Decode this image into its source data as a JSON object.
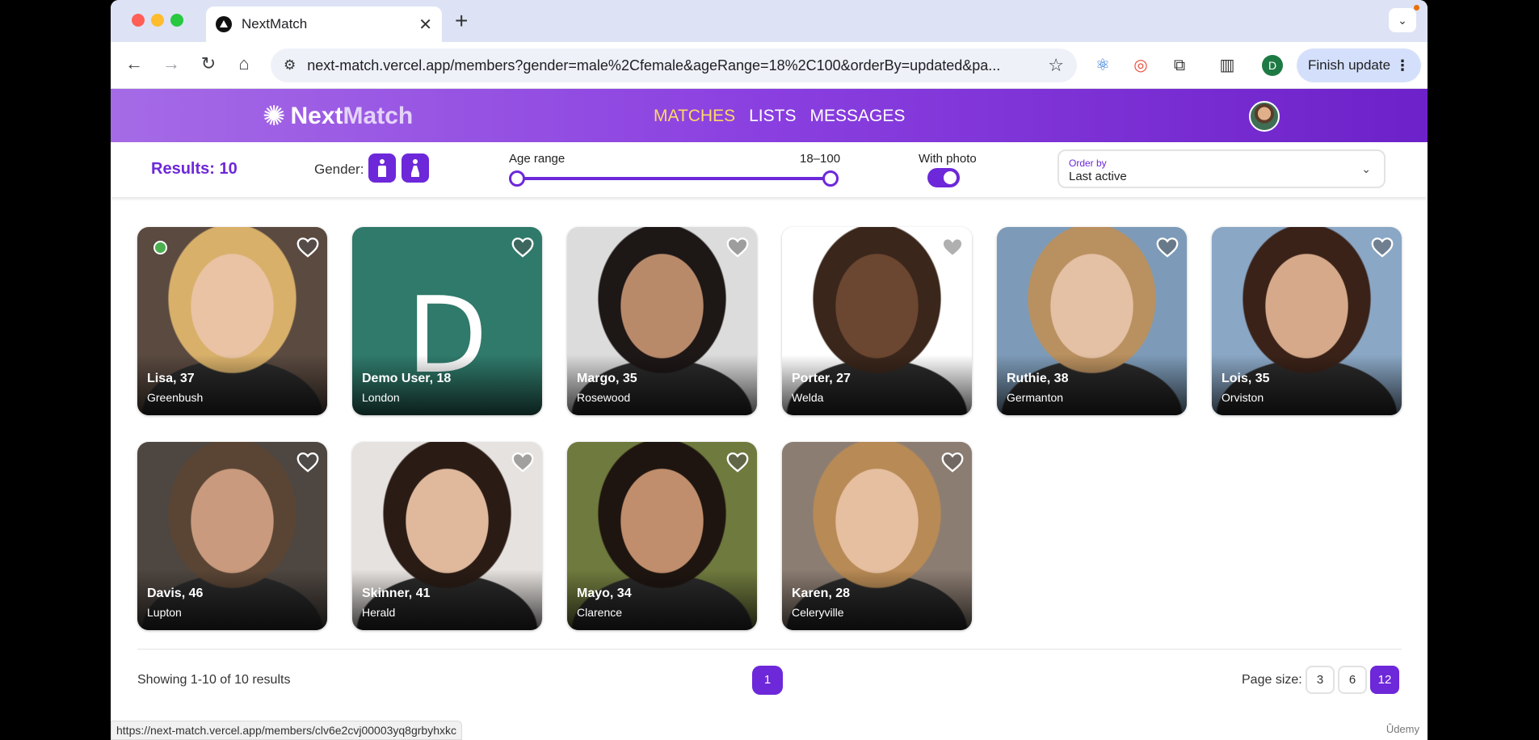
{
  "browser": {
    "tab_title": "NextMatch",
    "url": "next-match.vercel.app/members?gender=male%2Cfemale&ageRange=18%2C100&orderBy=updated&pa...",
    "finish_update": "Finish update",
    "profile_initial": "D",
    "status_url": "https://next-match.vercel.app/members/clv6e2cvj00003yq8grbyhxkc"
  },
  "app": {
    "logo": {
      "part1": "Next",
      "part2": "Match"
    },
    "nav": [
      {
        "label": "MATCHES",
        "active": true
      },
      {
        "label": "LISTS",
        "active": false
      },
      {
        "label": "MESSAGES",
        "active": false
      }
    ]
  },
  "filters": {
    "results": "Results: 10",
    "gender_label": "Gender:",
    "age_label": "Age range",
    "age_value": "18–100",
    "age_range": [
      18,
      100
    ],
    "with_photo_label": "With photo",
    "with_photo": true,
    "order_by_label": "Order by",
    "order_by_value": "Last active"
  },
  "members": [
    {
      "name": "Lisa, 37",
      "city": "Greenbush",
      "online": true,
      "photo": "photo",
      "skin": "#e9c3a4",
      "hair": "#d8b06a",
      "bg": "#5a4a40"
    },
    {
      "name": "Demo User, 18",
      "city": "London",
      "online": false,
      "photo": "initial",
      "initial": "D"
    },
    {
      "name": "Margo, 35",
      "city": "Rosewood",
      "online": false,
      "photo": "photo",
      "skin": "#b98a6a",
      "hair": "#1d1716",
      "bg": "#dcdcdc"
    },
    {
      "name": "Porter, 27",
      "city": "Welda",
      "online": false,
      "photo": "photo",
      "skin": "#6b4630",
      "hair": "#3a261b",
      "bg": "#ffffff"
    },
    {
      "name": "Ruthie, 38",
      "city": "Germanton",
      "online": false,
      "photo": "photo",
      "skin": "#e4c0a5",
      "hair": "#b9905f",
      "bg": "#7d9bb8"
    },
    {
      "name": "Lois, 35",
      "city": "Orviston",
      "online": false,
      "photo": "photo",
      "skin": "#d6a98a",
      "hair": "#3a2218",
      "bg": "#8aa7c5"
    },
    {
      "name": "Davis, 46",
      "city": "Lupton",
      "online": false,
      "photo": "photo",
      "skin": "#c99a7d",
      "hair": "#5a4535",
      "bg": "#4e4640"
    },
    {
      "name": "Skinner, 41",
      "city": "Herald",
      "online": false,
      "photo": "photo",
      "skin": "#e0b89c",
      "hair": "#2a1c15",
      "bg": "#e6e2df"
    },
    {
      "name": "Mayo, 34",
      "city": "Clarence",
      "online": false,
      "photo": "photo",
      "skin": "#c08e6c",
      "hair": "#1e1510",
      "bg": "#6f7a3e"
    },
    {
      "name": "Karen, 28",
      "city": "Celeryville",
      "online": false,
      "photo": "photo",
      "skin": "#e6bfa0",
      "hair": "#b88a55",
      "bg": "#8c7d72"
    }
  ],
  "footer": {
    "showing": "Showing 1-10 of 10 results",
    "current_page": "1",
    "page_size_label": "Page size:",
    "page_sizes": [
      "3",
      "6",
      "12"
    ],
    "selected_page_size": "12"
  },
  "watermark": "Ûdemy",
  "colors": {
    "primary": "#6d28d9",
    "nav_active": "#ffd866",
    "online": "#4caf50"
  }
}
